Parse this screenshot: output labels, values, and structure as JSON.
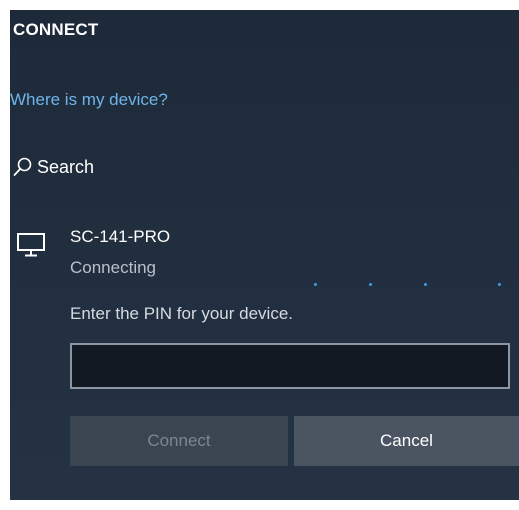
{
  "panel": {
    "title": "CONNECT",
    "where_link": "Where is my device?",
    "search_label": "Search"
  },
  "device": {
    "name": "SC-141-PRO",
    "status": "Connecting",
    "icon": "monitor-icon"
  },
  "pin": {
    "prompt": "Enter the PIN for your device.",
    "value": "",
    "placeholder": ""
  },
  "buttons": {
    "connect_label": "Connect",
    "cancel_label": "Cancel"
  },
  "colors": {
    "panel_bg": "#1f2b3a",
    "link": "#6fb3e8",
    "progress_dot": "#3a9be6",
    "input_bg": "#121922",
    "input_border": "#8b96a3",
    "connect_disabled_bg": "#3b4552",
    "cancel_bg": "#4b5562"
  }
}
